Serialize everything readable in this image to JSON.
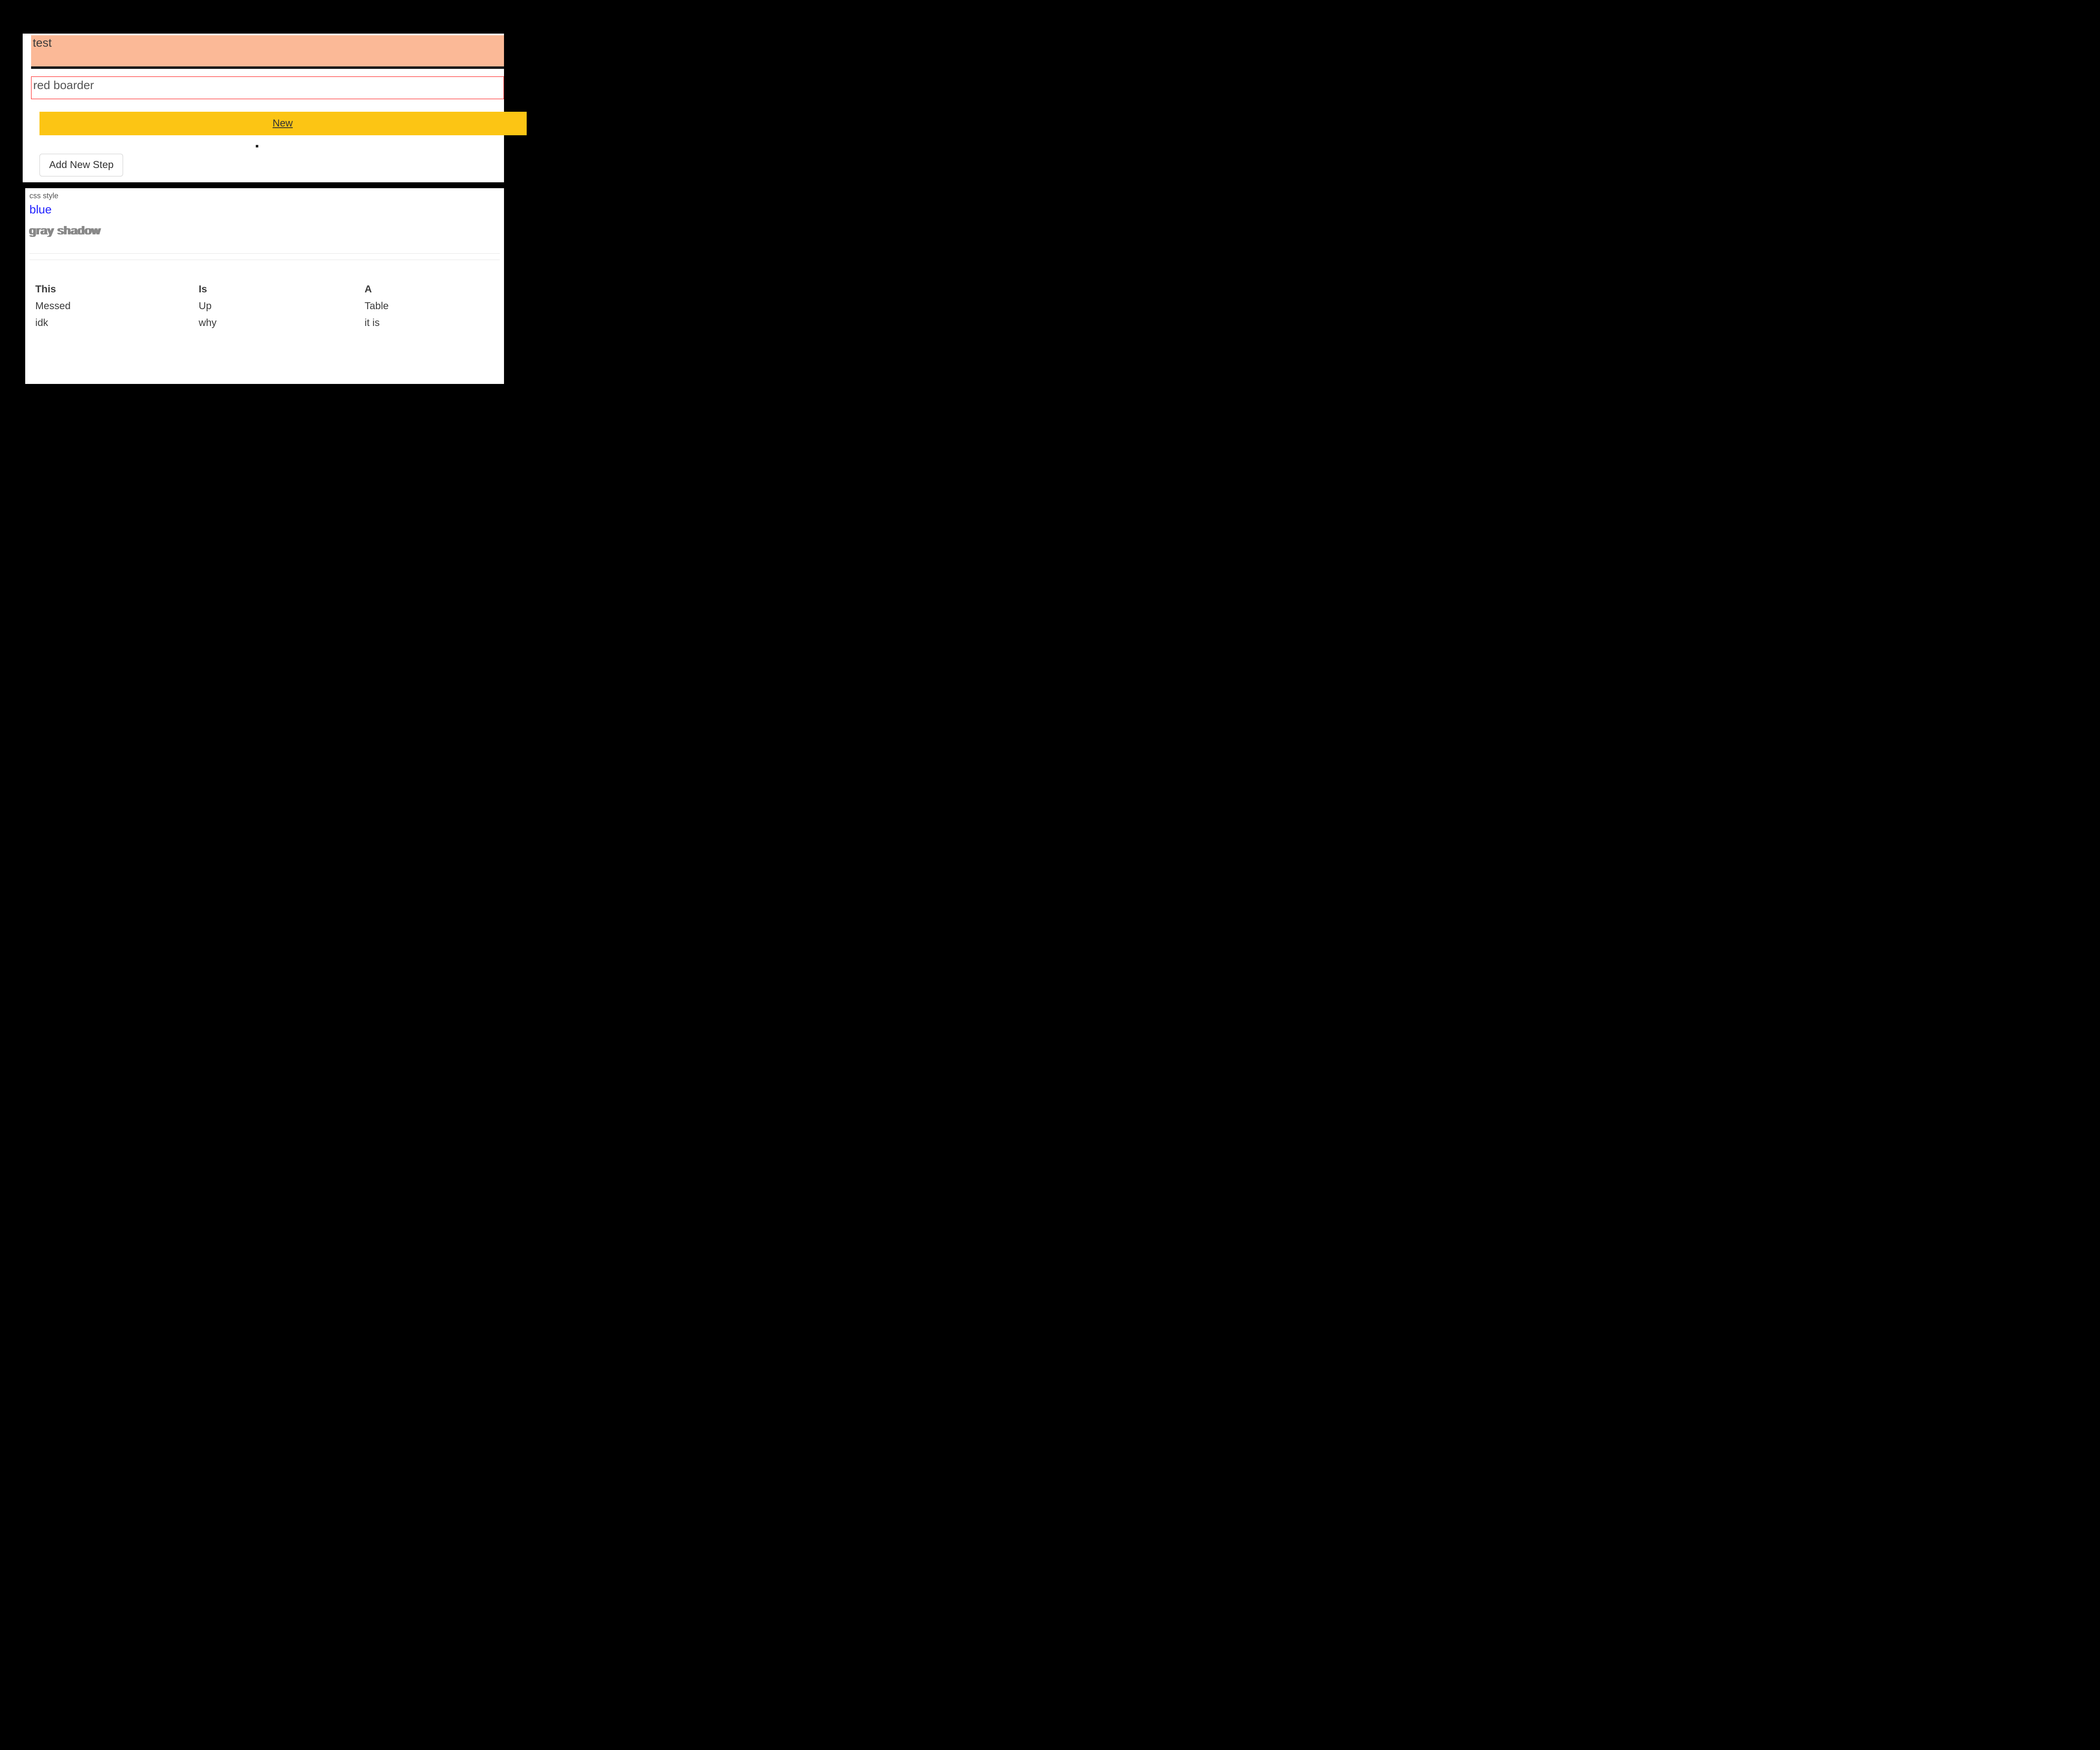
{
  "top": {
    "test_label": "test",
    "red_box_text": "red boarder",
    "new_link": "New",
    "add_step_label": "Add New Step"
  },
  "bottom": {
    "css_label": "css style",
    "blue_text": "blue",
    "gray_shadow_text": "gray shadow"
  },
  "table": {
    "headers": [
      "This",
      "Is",
      "A"
    ],
    "rows": [
      [
        "Messed",
        "Up",
        "Table"
      ],
      [
        "idk",
        "why",
        "it is"
      ]
    ]
  }
}
